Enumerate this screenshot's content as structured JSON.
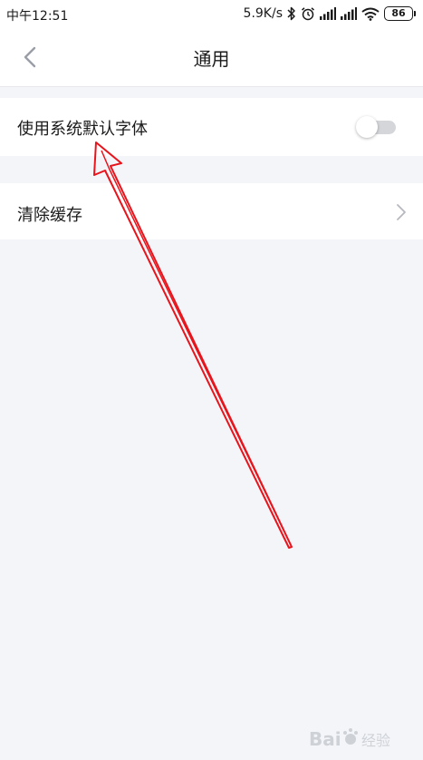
{
  "status_bar": {
    "time": "中午12:51",
    "net_speed": "5.9K/s",
    "battery": "86",
    "icons": [
      "bluetooth-icon",
      "alarm-icon",
      "signal-icon",
      "signal-icon",
      "wifi-icon",
      "battery-icon"
    ]
  },
  "header": {
    "title": "通用",
    "back_icon": "chevron-left-icon"
  },
  "settings": {
    "system_font": {
      "label": "使用系统默认字体",
      "enabled": false
    },
    "clear_cache": {
      "label": "清除缓存",
      "icon": "chevron-right-icon"
    }
  },
  "annotation": {
    "color": "#e8141c"
  },
  "watermark": {
    "text": "Baidu 经验"
  },
  "colors": {
    "background": "#f3f5f9",
    "toggle_off_track": "#d4d6da",
    "arrow": "#e8141c"
  }
}
